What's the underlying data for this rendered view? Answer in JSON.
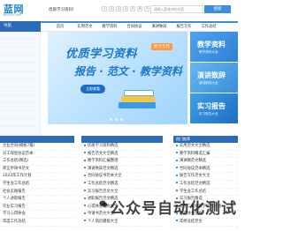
{
  "header": {
    "logo": "蓝网",
    "logo_url": "lanpian.com",
    "slogan": "优质学习资料!",
    "page_nums": [
      "1",
      "2",
      "3",
      "4",
      "5",
      "6",
      "7"
    ],
    "search_placeholder": "请输入要查询的内容",
    "search_button": "搜索"
  },
  "nav": {
    "side_label": "导航",
    "items": [
      "首页",
      "实用范文",
      "教学资料",
      "合同协议",
      "演讲致辞",
      "报告写作",
      "工作总结"
    ]
  },
  "banner": {
    "title": "优质学习资料",
    "tag": "新文写作",
    "subtitle": "报告 · 范文 · 教学资料",
    "button": "立即查看"
  },
  "cards": [
    {
      "title": "教学资料",
      "sub": "教学资料大全"
    },
    {
      "title": "演讲致辞",
      "sub": "演讲致辞大全"
    },
    {
      "title": "实习报告",
      "sub": "实习报告大全"
    }
  ],
  "lists": {
    "col1": {
      "head": "",
      "rows": [
        {
          "text": "企业合同(模板7篇)",
          "date": ""
        },
        {
          "text": "员工保密协议范本",
          "date": ""
        },
        {
          "text": "工作总结(精选)",
          "date": ""
        },
        {
          "text": "转正申请书范文",
          "date": ""
        },
        {
          "text": "2022年工作计划",
          "date": ""
        },
        {
          "text": "学生会工作总结",
          "date": ""
        },
        {
          "text": "社会实践报告",
          "date": ""
        },
        {
          "text": "个人述职报告",
          "date": ""
        },
        {
          "text": "毕业实习报告",
          "date": ""
        },
        {
          "text": "学习心得体会",
          "date": ""
        },
        {
          "text": "年度工作总结",
          "date": ""
        }
      ]
    },
    "col2": {
      "head": "",
      "rows": [
        {
          "text": "优质学习资料精选",
          "date": ""
        },
        {
          "text": "报告范文大全精选",
          "date": ""
        },
        {
          "text": "教学资料汇编整理",
          "date": ""
        },
        {
          "text": "演讲致辞范文精选",
          "date": ""
        },
        {
          "text": "合同协议书范本大全",
          "date": ""
        },
        {
          "text": "工作总结范文精选",
          "date": ""
        },
        {
          "text": "实习报告范文大全",
          "date": ""
        },
        {
          "text": "述职报告范文精选",
          "date": ""
        },
        {
          "text": "心得体会范文大全",
          "date": ""
        },
        {
          "text": "申请书范文大全",
          "date": ""
        },
        {
          "text": "个人简历模板大全",
          "date": ""
        }
      ]
    },
    "col3": {
      "head": "热门推荐",
      "rows": [
        {
          "text": "实用范文大全精选",
          "date": ""
        },
        {
          "text": "教学资料精选汇编",
          "date": ""
        },
        {
          "text": "演讲稿范文精选",
          "date": ""
        },
        {
          "text": "合同协议范本精选",
          "date": ""
        },
        {
          "text": "报告写作范文大全",
          "date": ""
        },
        {
          "text": "工作总结范文精选",
          "date": ""
        },
        {
          "text": "学生会工作总结",
          "date": ""
        },
        {
          "text": "实习报告精选",
          "date": ""
        },
        {
          "text": "小学二年级教学工作计划",
          "date": ""
        },
        {
          "text": "心得体会范文",
          "date": ""
        },
        {
          "text": "年终总结范文",
          "date": ""
        }
      ]
    }
  },
  "watermark": "公众号自动化测试"
}
